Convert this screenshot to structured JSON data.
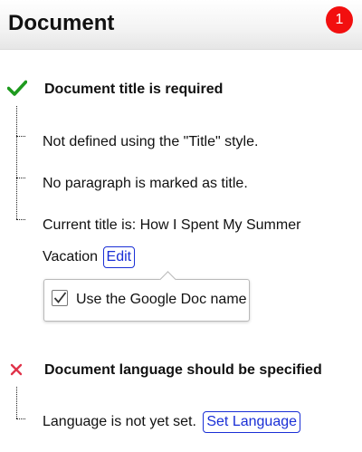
{
  "header": {
    "title": "Document",
    "badge_count": "1"
  },
  "sections": [
    {
      "status": "pass",
      "title": "Document title is required",
      "items": [
        "Not defined using the \"Title\" style.",
        "No paragraph is marked as title.",
        "Current title is: How I Spent My Summer"
      ],
      "continuation": "Vacation",
      "action_label": "Edit",
      "popover": {
        "checkbox_label": "Use the Google Doc name",
        "checked": true
      }
    },
    {
      "status": "fail",
      "title": "Document language should be specified",
      "items": [
        "Language is not yet set."
      ],
      "action_label": "Set Language"
    }
  ],
  "colors": {
    "badge": "#f20f0f",
    "pass": "#1e9a1e",
    "fail": "#e0334a",
    "link": "#1a2fd6"
  }
}
